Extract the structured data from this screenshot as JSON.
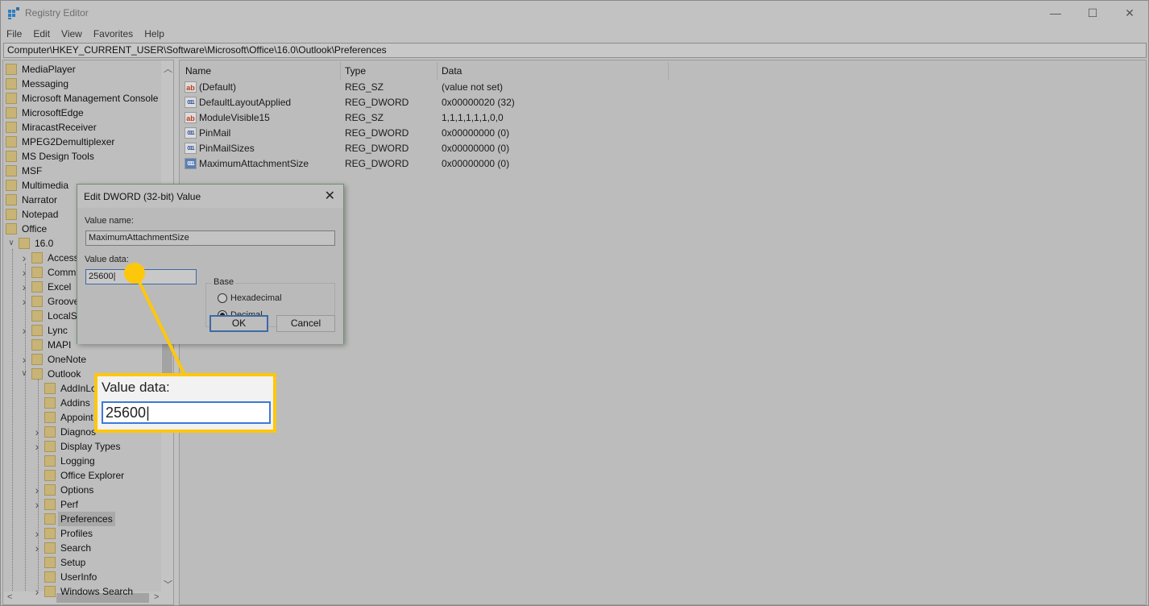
{
  "window": {
    "title": "Registry Editor",
    "minimize": "—",
    "maximize": "☐",
    "close": "✕"
  },
  "menu": [
    "File",
    "Edit",
    "View",
    "Favorites",
    "Help"
  ],
  "address": "Computer\\HKEY_CURRENT_USER\\Software\\Microsoft\\Office\\16.0\\Outlook\\Preferences",
  "tree": [
    {
      "label": "MediaPlayer",
      "level": 0,
      "exp": ""
    },
    {
      "label": "Messaging",
      "level": 0,
      "exp": ""
    },
    {
      "label": "Microsoft Management Console",
      "level": 0,
      "exp": ""
    },
    {
      "label": "MicrosoftEdge",
      "level": 0,
      "exp": ""
    },
    {
      "label": "MiracastReceiver",
      "level": 0,
      "exp": ""
    },
    {
      "label": "MPEG2Demultiplexer",
      "level": 0,
      "exp": ""
    },
    {
      "label": "MS Design Tools",
      "level": 0,
      "exp": ""
    },
    {
      "label": "MSF",
      "level": 0,
      "exp": ""
    },
    {
      "label": "Multimedia",
      "level": 0,
      "exp": ""
    },
    {
      "label": "Narrator",
      "level": 0,
      "exp": ""
    },
    {
      "label": "Notepad",
      "level": 0,
      "exp": ""
    },
    {
      "label": "Office",
      "level": 0,
      "exp": ""
    },
    {
      "label": "16.0",
      "level": 1,
      "exp": "expanded"
    },
    {
      "label": "Access",
      "level": 2,
      "exp": "collapsed"
    },
    {
      "label": "Comm",
      "level": 2,
      "exp": "collapsed"
    },
    {
      "label": "Excel",
      "level": 2,
      "exp": "collapsed"
    },
    {
      "label": "Groove",
      "level": 2,
      "exp": "collapsed"
    },
    {
      "label": "LocalSy",
      "level": 2,
      "exp": ""
    },
    {
      "label": "Lync",
      "level": 2,
      "exp": "collapsed"
    },
    {
      "label": "MAPI",
      "level": 2,
      "exp": ""
    },
    {
      "label": "OneNote",
      "level": 2,
      "exp": "collapsed"
    },
    {
      "label": "Outlook",
      "level": 2,
      "exp": "expanded"
    },
    {
      "label": "AddInLo",
      "level": 3,
      "exp": ""
    },
    {
      "label": "Addins",
      "level": 3,
      "exp": ""
    },
    {
      "label": "Appoint",
      "level": 3,
      "exp": ""
    },
    {
      "label": "Diagnos",
      "level": 3,
      "exp": "collapsed"
    },
    {
      "label": "Display Types",
      "level": 3,
      "exp": "collapsed"
    },
    {
      "label": "Logging",
      "level": 3,
      "exp": ""
    },
    {
      "label": "Office Explorer",
      "level": 3,
      "exp": ""
    },
    {
      "label": "Options",
      "level": 3,
      "exp": "collapsed"
    },
    {
      "label": "Perf",
      "level": 3,
      "exp": "collapsed"
    },
    {
      "label": "Preferences",
      "level": 3,
      "exp": "",
      "selected": true
    },
    {
      "label": "Profiles",
      "level": 3,
      "exp": "collapsed"
    },
    {
      "label": "Search",
      "level": 3,
      "exp": "collapsed"
    },
    {
      "label": "Setup",
      "level": 3,
      "exp": ""
    },
    {
      "label": "UserInfo",
      "level": 3,
      "exp": ""
    },
    {
      "label": "Windows Search",
      "level": 3,
      "exp": "collapsed"
    }
  ],
  "list": {
    "headers": [
      "Name",
      "Type",
      "Data"
    ],
    "rows": [
      {
        "icon": "string-value-icon",
        "name": "(Default)",
        "type": "REG_SZ",
        "data": "(value not set)"
      },
      {
        "icon": "dword-value-icon",
        "name": "DefaultLayoutApplied",
        "type": "REG_DWORD",
        "data": "0x00000020 (32)"
      },
      {
        "icon": "string-value-icon",
        "name": "ModuleVisible15",
        "type": "REG_SZ",
        "data": "1,1,1,1,1,1,0,0"
      },
      {
        "icon": "dword-value-icon",
        "name": "PinMail",
        "type": "REG_DWORD",
        "data": "0x00000000 (0)"
      },
      {
        "icon": "dword-value-icon",
        "name": "PinMailSizes",
        "type": "REG_DWORD",
        "data": "0x00000000 (0)"
      },
      {
        "icon": "dword-value-icon",
        "name": "MaximumAttachmentSize",
        "type": "REG_DWORD",
        "data": "0x00000000 (0)",
        "selected": true
      }
    ]
  },
  "dialog": {
    "title": "Edit DWORD (32-bit) Value",
    "close": "✕",
    "value_name_label": "Value name:",
    "value_name": "MaximumAttachmentSize",
    "value_data_label": "Value data:",
    "value_data": "25600",
    "base_label": "Base",
    "base_options": [
      {
        "label": "Hexadecimal",
        "checked": false
      },
      {
        "label": "Decimal",
        "checked": true
      }
    ],
    "ok": "OK",
    "cancel": "Cancel"
  },
  "callout": {
    "label": "Value data:",
    "value": "25600",
    "color": "#fdc70c"
  }
}
